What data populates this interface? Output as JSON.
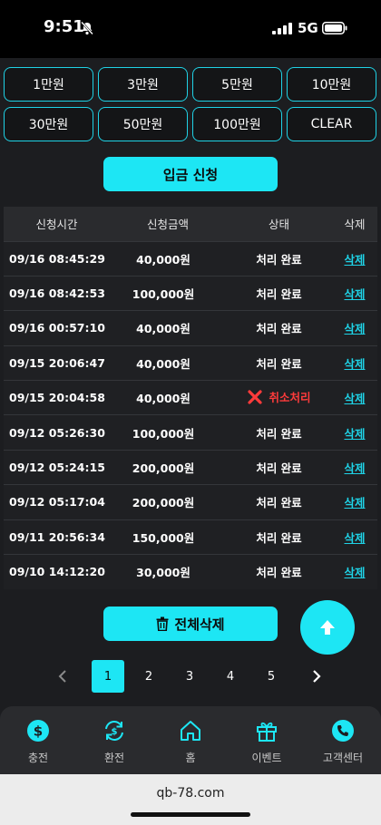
{
  "status_bar": {
    "time": "9:51",
    "network": "5G"
  },
  "amounts": [
    "1만원",
    "3만원",
    "5만원",
    "10만원",
    "30만원",
    "50만원",
    "100만원",
    "CLEAR"
  ],
  "deposit_button": "입금 신청",
  "table": {
    "headers": [
      "신청시간",
      "신청금액",
      "상태",
      "삭제"
    ],
    "rows": [
      {
        "time": "09/16 08:45:29",
        "amount": "40,000원",
        "status": "처리 완료",
        "action": "삭제",
        "cancelled": false
      },
      {
        "time": "09/16 08:42:53",
        "amount": "100,000원",
        "status": "처리 완료",
        "action": "삭제",
        "cancelled": false
      },
      {
        "time": "09/16 00:57:10",
        "amount": "40,000원",
        "status": "처리 완료",
        "action": "삭제",
        "cancelled": false
      },
      {
        "time": "09/15 20:06:47",
        "amount": "40,000원",
        "status": "처리 완료",
        "action": "삭제",
        "cancelled": false
      },
      {
        "time": "09/15 20:04:58",
        "amount": "40,000원",
        "status": "취소처리",
        "action": "삭제",
        "cancelled": true
      },
      {
        "time": "09/12 05:26:30",
        "amount": "100,000원",
        "status": "처리 완료",
        "action": "삭제",
        "cancelled": false
      },
      {
        "time": "09/12 05:24:15",
        "amount": "200,000원",
        "status": "처리 완료",
        "action": "삭제",
        "cancelled": false
      },
      {
        "time": "09/12 05:17:04",
        "amount": "200,000원",
        "status": "처리 완료",
        "action": "삭제",
        "cancelled": false
      },
      {
        "time": "09/11 20:56:34",
        "amount": "150,000원",
        "status": "처리 완료",
        "action": "삭제",
        "cancelled": false
      },
      {
        "time": "09/10 14:12:20",
        "amount": "30,000원",
        "status": "처리 완료",
        "action": "삭제",
        "cancelled": false
      }
    ]
  },
  "delete_all_button": "전체삭제",
  "pagination": {
    "pages": [
      "1",
      "2",
      "3",
      "4",
      "5"
    ],
    "current": "1"
  },
  "nav": [
    {
      "label": "충전",
      "icon": "dollar-coin-icon"
    },
    {
      "label": "환전",
      "icon": "exchange-icon"
    },
    {
      "label": "홈",
      "icon": "home-icon"
    },
    {
      "label": "이벤트",
      "icon": "gift-icon"
    },
    {
      "label": "고객센터",
      "icon": "phone-icon"
    }
  ],
  "browser": {
    "url": "qb-78.com"
  },
  "colors": {
    "accent": "#1de6f4",
    "background": "#1c1d20",
    "cancel": "#ff3b3b"
  }
}
